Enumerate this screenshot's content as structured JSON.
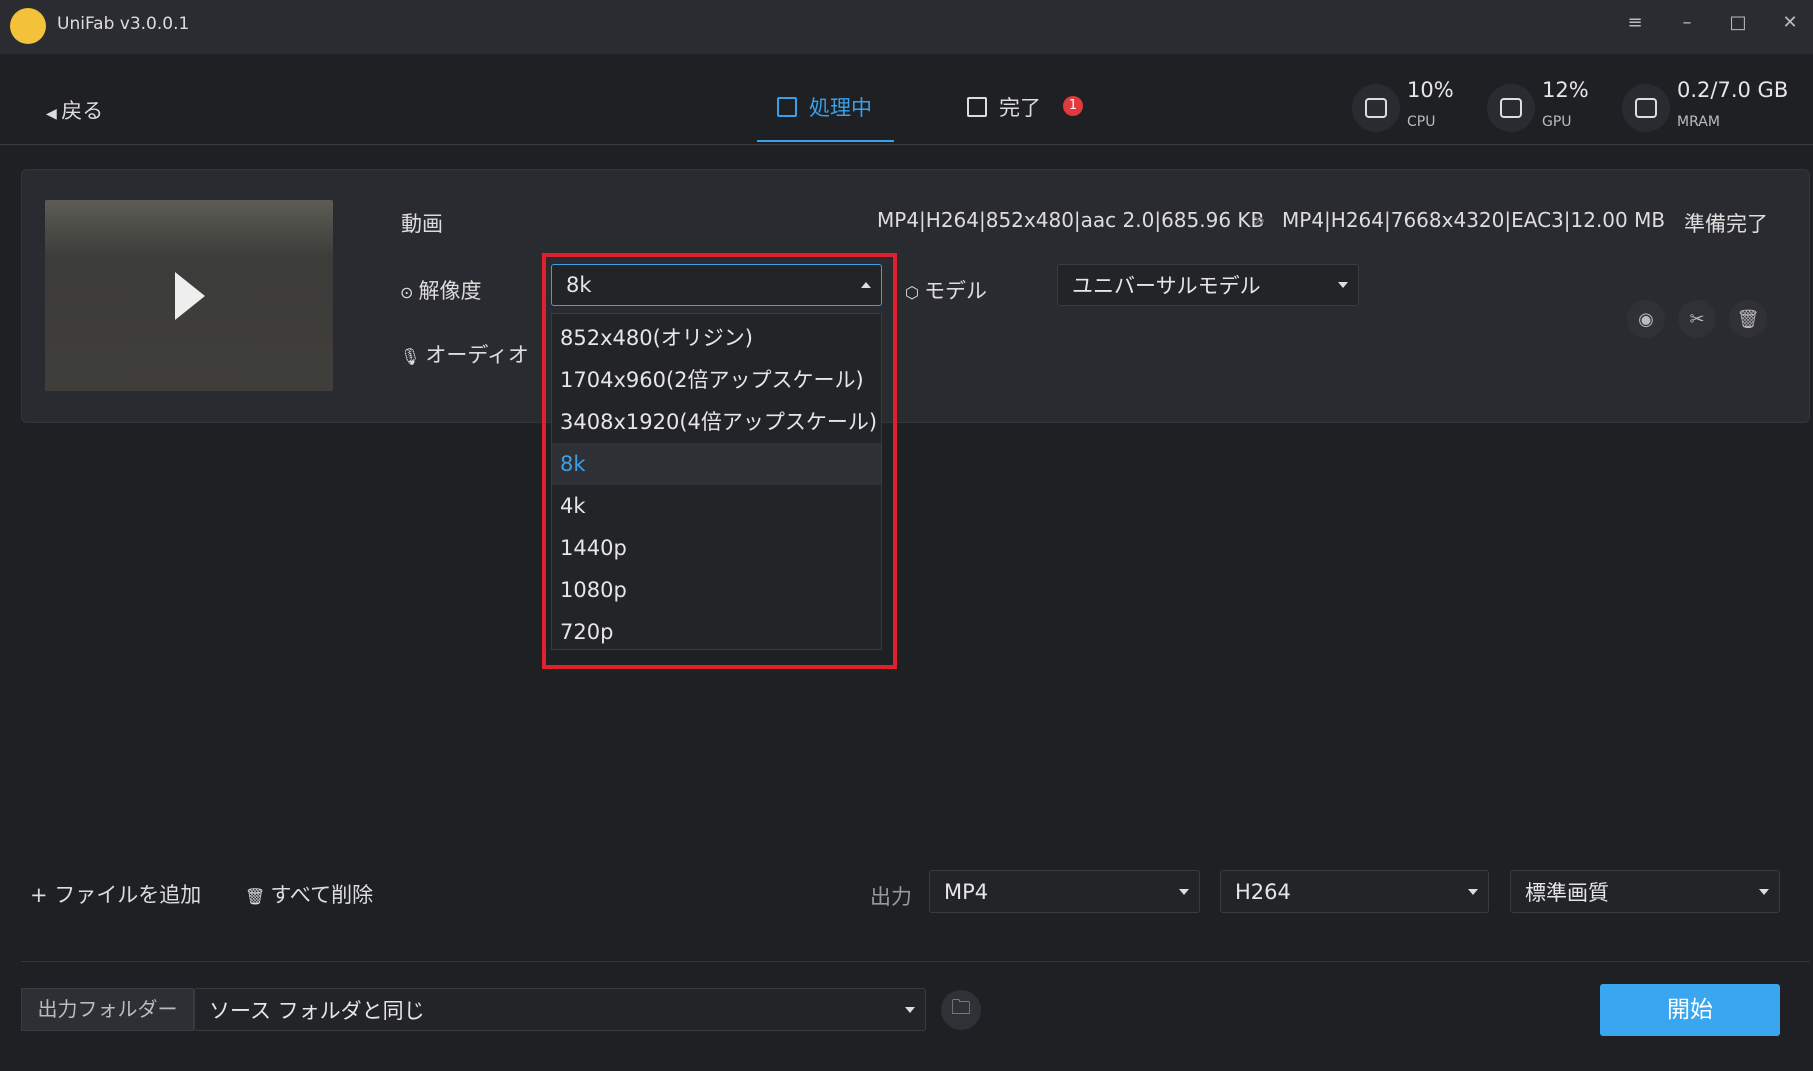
{
  "app": {
    "title": "UniFab v3.0.0.1"
  },
  "window": {
    "menu": "≡",
    "minimize": "–",
    "maximize": "□",
    "close": "✕"
  },
  "header": {
    "back": "戻る",
    "tabs": [
      {
        "label": "処理中"
      },
      {
        "label": "完了",
        "badge": "1"
      }
    ],
    "stats": [
      {
        "value": "10%",
        "label": "CPU"
      },
      {
        "value": "12%",
        "label": "GPU"
      },
      {
        "value": "0.2/7.0 GB",
        "label": "MRAM"
      }
    ]
  },
  "task": {
    "type_label": "動画",
    "info_src": "MP4|H264|852x480|aac 2.0|685.96 KB",
    "arrow": "»",
    "info_dst": "MP4|H264|7668x4320|EAC3|12.00 MB",
    "status": "準備完了",
    "resolution_label": "解像度",
    "resolution_value": "8k",
    "audio_label": "オーディオ",
    "model_label": "モデル",
    "model_value": "ユニバーサルモデル",
    "resolution_options": [
      "852x480(オリジン)",
      "1704x960(2倍アップスケール)",
      "3408x1920(4倍アップスケール)",
      "8k",
      "4k",
      "1440p",
      "1080p",
      "720p"
    ]
  },
  "bottom": {
    "add_file": "+ ファイルを追加",
    "delete_all": "すべて削除",
    "output_label": "出力",
    "format": "MP4",
    "codec": "H264",
    "quality": "標準画質",
    "folder_label": "出力フォルダー",
    "folder_value": "ソース フォルダと同じ",
    "start": "開始"
  },
  "colors": {
    "accent": "#3aa0e8",
    "highlight": "#e0202a"
  }
}
